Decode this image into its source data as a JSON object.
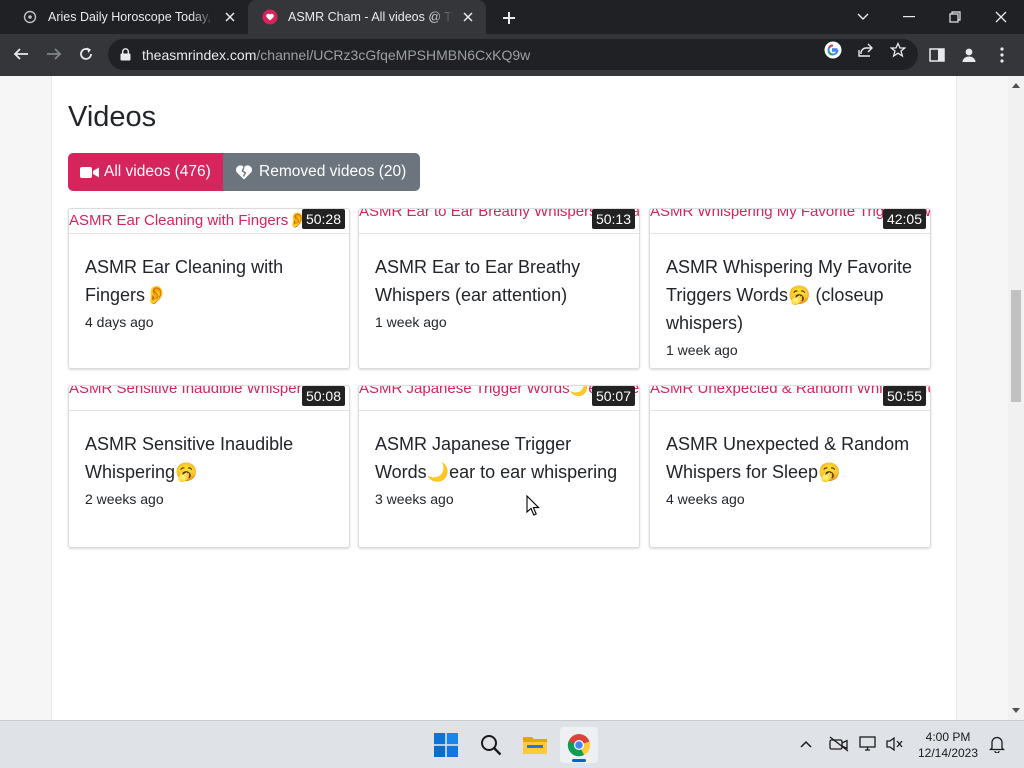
{
  "browser": {
    "tabs": [
      {
        "title": "Aries Daily Horoscope Today, Dec",
        "active": false
      },
      {
        "title": "ASMR Cham - All videos @ The A",
        "active": true
      }
    ],
    "url_host": "theasmrindex.com",
    "url_path": "/channel/UCRz3cGfqeMPSHMBN6CxKQ9w"
  },
  "page": {
    "heading": "Videos",
    "filters": {
      "all_label": "All videos (476)",
      "removed_label": "Removed videos (20)"
    },
    "videos": [
      {
        "alt": "ASMR Ear Cleaning with Fingers👂",
        "duration": "50:28",
        "title": "ASMR Ear Cleaning with Fingers👂",
        "time": "4 days ago"
      },
      {
        "alt": "ASMR Ear to Ear Breathy Whispers (ear attention)",
        "duration": "50:13",
        "title": "ASMR Ear to Ear Breathy Whispers (ear attention)",
        "time": "1 week ago"
      },
      {
        "alt": "ASMR Whispering My Favorite Triggers Words🥱 (closeup whispers)",
        "duration": "42:05",
        "title": "ASMR Whispering My Favorite Triggers Words🥱 (closeup whispers)",
        "time": "1 week ago"
      },
      {
        "alt": "ASMR Sensitive Inaudible Whispering🥱",
        "duration": "50:08",
        "title": "ASMR Sensitive Inaudible Whispering🥱",
        "time": "2 weeks ago"
      },
      {
        "alt": "ASMR Japanese Trigger Words🌙ear to ear whispering",
        "duration": "50:07",
        "title": "ASMR Japanese Trigger Words🌙ear to ear whispering",
        "time": "3 weeks ago"
      },
      {
        "alt": "ASMR Unexpected & Random Whispers for Sleep🥱",
        "duration": "50:55",
        "title": "ASMR Unexpected & Random Whispers for Sleep🥱",
        "time": "4 weeks ago"
      }
    ]
  },
  "taskbar": {
    "time": "4:00 PM",
    "date": "12/14/2023"
  },
  "colors": {
    "accent": "#d6245d",
    "secondary": "#6c757d"
  }
}
